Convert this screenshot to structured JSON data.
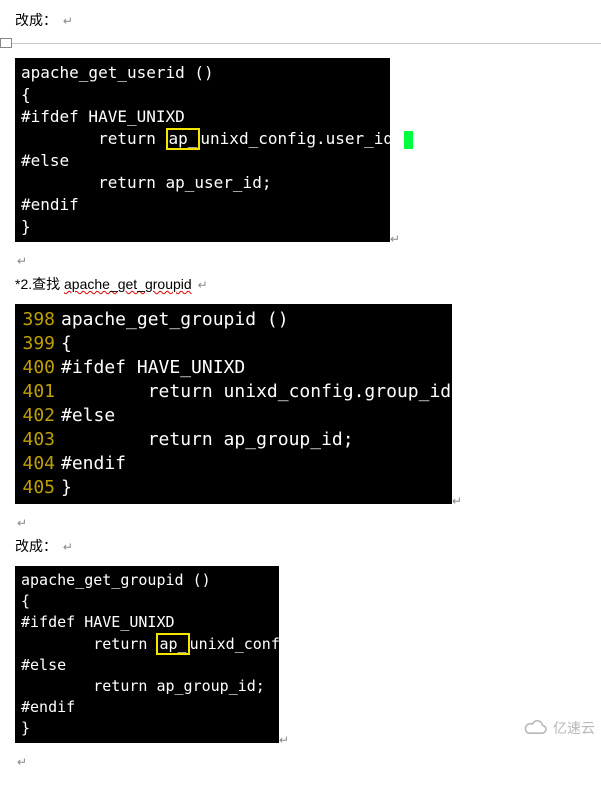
{
  "text": {
    "changeTo1": "改成：",
    "changeTo2": "改成：",
    "step2_prefix": "*2.查找 ",
    "step2_target": "apache_get_groupid",
    "paraMark": "↵",
    "watermark": "亿速云"
  },
  "code1": {
    "l1": "apache_get_userid ()",
    "l2": "{",
    "l3": "#ifdef HAVE_UNIXD",
    "l4_indent": "        return ",
    "l4_hl": "ap_",
    "l4_rest": "unixd_config.user_id;",
    "l5": "#else",
    "l6": "        return ap_user_id;",
    "l7": "#endif",
    "l8": "}"
  },
  "code2": {
    "lines": [
      {
        "n": "398",
        "t": "apache_get_groupid ()"
      },
      {
        "n": "399",
        "t": "{"
      },
      {
        "n": "400",
        "t": "#ifdef HAVE_UNIXD"
      },
      {
        "n": "401",
        "t": "        return unixd_config.group_id;"
      },
      {
        "n": "402",
        "t": "#else"
      },
      {
        "n": "403",
        "t": "        return ap_group_id;"
      },
      {
        "n": "404",
        "t": "#endif"
      },
      {
        "n": "405",
        "t": "}"
      }
    ]
  },
  "code3": {
    "l1": "apache_get_groupid ()",
    "l2": "{",
    "l3": "#ifdef HAVE_UNIXD",
    "l4_indent": "        return ",
    "l4_hl": "ap_",
    "l4_rest": "unixd_confi",
    "l5": "#else",
    "l6": "        return ap_group_id;",
    "l7": "#endif",
    "l8": "}"
  }
}
